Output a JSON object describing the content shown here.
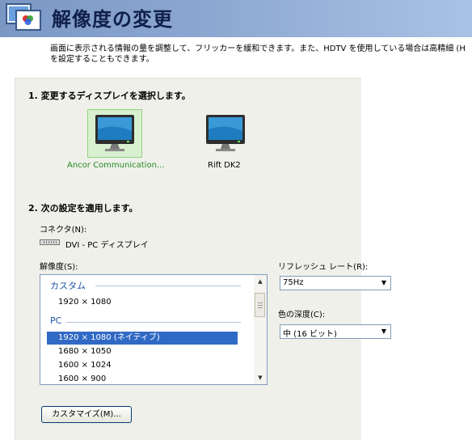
{
  "header": {
    "title": "解像度の変更",
    "icon": "display-settings-icon"
  },
  "description": "画面に表示される情報の量を調整して、フリッカーを緩和できます。また、HDTV を使用している場合は高精細 (H\nを設定することもできます。",
  "step1": {
    "title": "1. 変更するディスプレイを選択します。",
    "monitors": [
      {
        "label": "Ancor Communication...",
        "selected": true
      },
      {
        "label": "Rift DK2",
        "selected": false
      }
    ]
  },
  "step2": {
    "title": "2. 次の設定を適用します。",
    "connector_label": "コネクタ(N):",
    "connector_value": "DVI - PC ディスプレイ",
    "resolution_label": "解像度(S):",
    "resolution_groups": [
      {
        "name": "カスタム",
        "items": [
          "1920 × 1080"
        ]
      },
      {
        "name": "PC",
        "items": [
          "1920 × 1080 (ネイティブ)",
          "1680 × 1050",
          "1600 × 1024",
          "1600 × 900"
        ]
      }
    ],
    "selected_resolution": "1920 × 1080 (ネイティブ)",
    "refresh_label": "リフレッシュ レート(R):",
    "refresh_value": "75Hz",
    "color_depth_label": "色の深度(C):",
    "color_depth_value": "中 (16 ビット)",
    "customize_button": "カスタマイズ(M)..."
  },
  "colors": {
    "header_start": "#7b97c4",
    "selected_green": "#d8f0d0",
    "monitor_label_green": "#228b22",
    "list_selection": "#316ac5",
    "group_blue": "#1f54a6"
  }
}
